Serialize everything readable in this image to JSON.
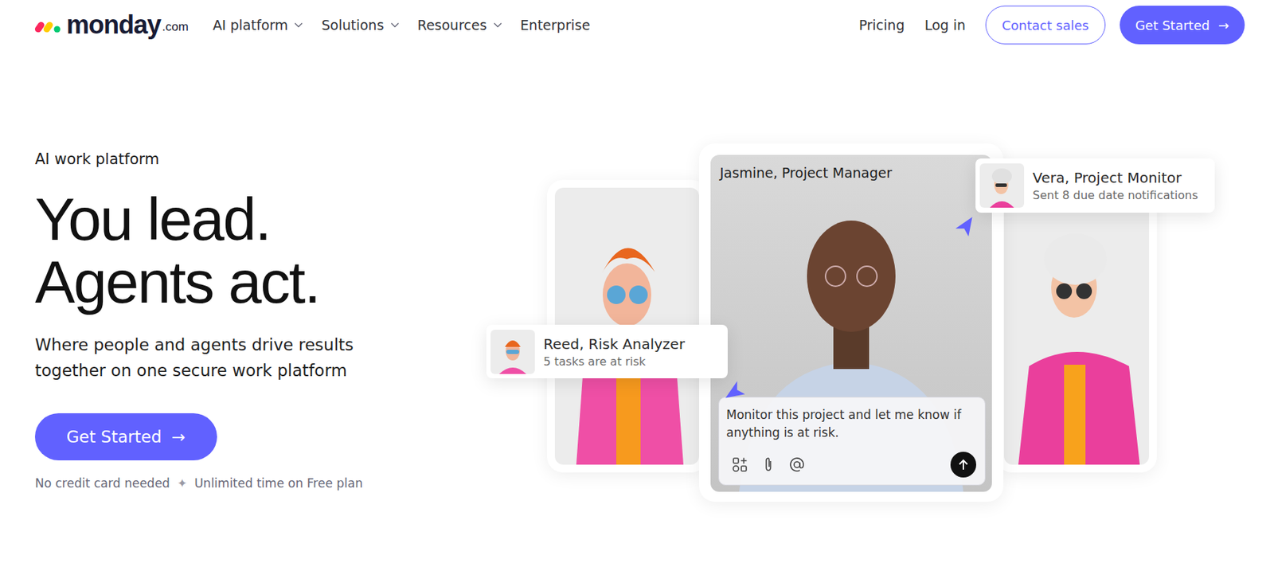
{
  "nav": {
    "logo": "monday",
    "logo_suffix": ".com",
    "items": [
      {
        "label": "AI platform",
        "has_dropdown": true
      },
      {
        "label": "Solutions",
        "has_dropdown": true
      },
      {
        "label": "Resources",
        "has_dropdown": true
      },
      {
        "label": "Enterprise",
        "has_dropdown": false
      }
    ],
    "links": [
      "Pricing",
      "Log in"
    ],
    "contact": "Contact sales",
    "get_started": "Get Started",
    "arrow": "→"
  },
  "hero": {
    "eyebrow": "AI work platform",
    "headline": [
      "You lead.",
      "Agents act."
    ],
    "subtitle": [
      "Where people and agents drive results",
      "together on one secure work platform"
    ],
    "cta": "Get Started",
    "cta_arrow": "→",
    "notes": [
      "No credit card needed",
      "Unlimited time on Free plan"
    ],
    "separator": "✦"
  },
  "illustration": {
    "main_label": "Jasmine, Project Manager",
    "agents": [
      {
        "name": "Vera, Project Monitor",
        "status": "Sent 8 due date notifications"
      },
      {
        "name": "Reed, Risk Analyzer",
        "status": "5 tasks are at risk"
      }
    ],
    "prompt": "Monitor this project and let me know if anything is at risk."
  }
}
